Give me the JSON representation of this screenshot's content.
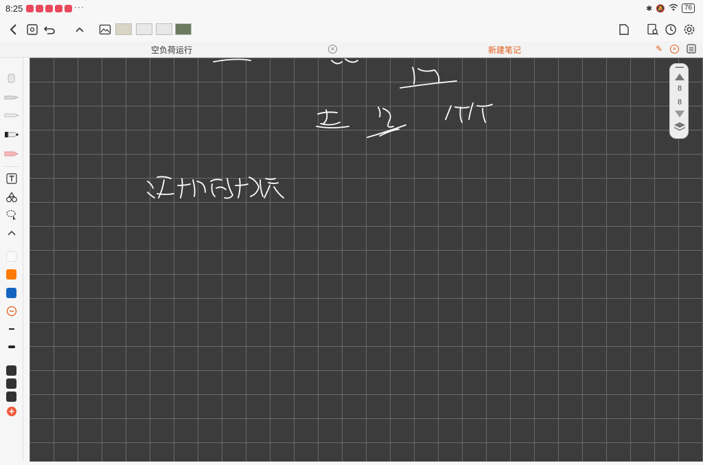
{
  "status": {
    "time": "8:25",
    "more": "···",
    "battery": "76"
  },
  "tabs": [
    {
      "label": "空负荷运行",
      "active": false
    },
    {
      "label": "新建笔记",
      "active": true
    }
  ],
  "colors": {
    "accent": "#e35e1a",
    "orange": "#ff7a00",
    "blue": "#1565c0",
    "canvas": "#3c3c3c",
    "grid": "#6a6a6a"
  },
  "page_panel": {
    "current": "8",
    "total": "8"
  },
  "handwriting": {
    "note": ""
  }
}
